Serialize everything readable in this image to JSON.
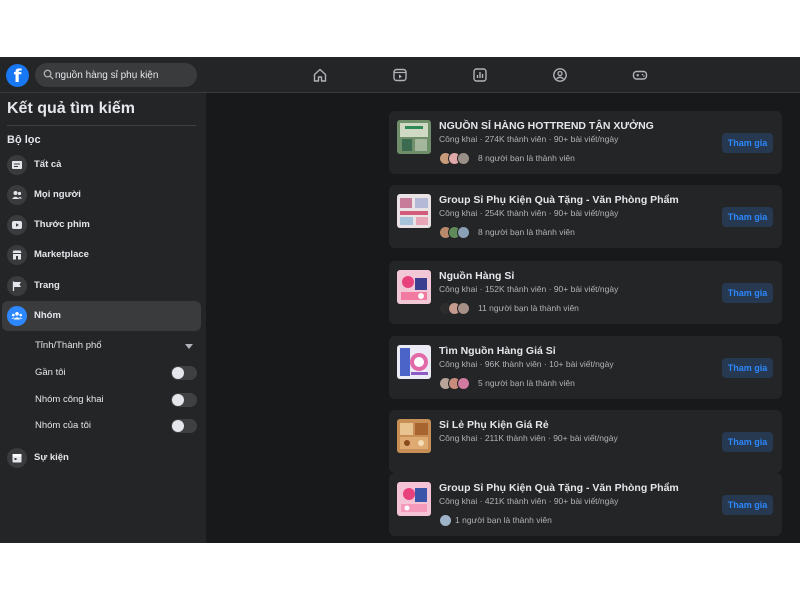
{
  "topbar": {
    "logo": "f",
    "search_value": "nguồn hàng sỉ phụ kiện",
    "nav_icons": [
      "home-icon",
      "watch-icon",
      "pages-icon",
      "groups-icon",
      "gaming-icon"
    ]
  },
  "sidebar": {
    "title": "Kết quả tìm kiếm",
    "filter_heading": "Bộ lọc",
    "items": [
      {
        "label": "Tất cả",
        "icon": "posts-icon"
      },
      {
        "label": "Mọi người",
        "icon": "people-icon"
      },
      {
        "label": "Thước phim",
        "icon": "video-icon"
      },
      {
        "label": "Marketplace",
        "icon": "shop-icon"
      },
      {
        "label": "Trang",
        "icon": "flag-icon"
      },
      {
        "label": "Nhóm",
        "icon": "groups-icon",
        "active": true
      },
      {
        "label": "Sự kiện",
        "icon": "calendar-icon"
      }
    ],
    "sub_filters": {
      "city": "Tỉnh/Thành phố",
      "near_me": "Gần tôi",
      "public_groups": "Nhóm công khai",
      "my_groups": "Nhóm của tôi"
    }
  },
  "results": [
    {
      "title": "NGUỒN SỈ HÀNG HOTTREND TẬN XƯỞNG",
      "meta": "Công khai · 274K thành viên · 90+ bài viết/ngày",
      "friends": "8 người bạn là thành viên",
      "join": "Tham gia"
    },
    {
      "title": "Group Sỉ Phụ Kiện Quà Tặng - Văn Phòng Phẩm",
      "meta": "Công khai · 254K thành viên · 90+ bài viết/ngày",
      "friends": "8 người bạn là thành viên",
      "join": "Tham gia"
    },
    {
      "title": "Nguồn Hàng Sỉ",
      "meta": "Công khai · 152K thành viên · 90+ bài viết/ngày",
      "friends": "11 người bạn là thành viên",
      "join": "Tham gia"
    },
    {
      "title": "Tìm Nguồn Hàng Giá Sỉ",
      "meta": "Công khai · 96K thành viên · 10+ bài viết/ngày",
      "friends": "5 người bạn là thành viên",
      "join": "Tham gia"
    },
    {
      "title": "Sỉ Lẻ Phụ Kiện Giá Rẻ",
      "meta": "Công khai · 211K thành viên · 90+ bài viết/ngày",
      "friends": "",
      "join": "Tham gia"
    },
    {
      "title": "Group Sỉ Phụ Kiện Quà Tặng - Văn Phòng Phẩm",
      "meta": "Công khai · 421K thành viên · 90+ bài viết/ngày",
      "friends": "1 người bạn là thành viên",
      "join": "Tham gia"
    }
  ],
  "colors": {
    "accent": "#2d88ff",
    "logo": "#1877f2",
    "surface": "#242526",
    "background": "#18191a"
  }
}
